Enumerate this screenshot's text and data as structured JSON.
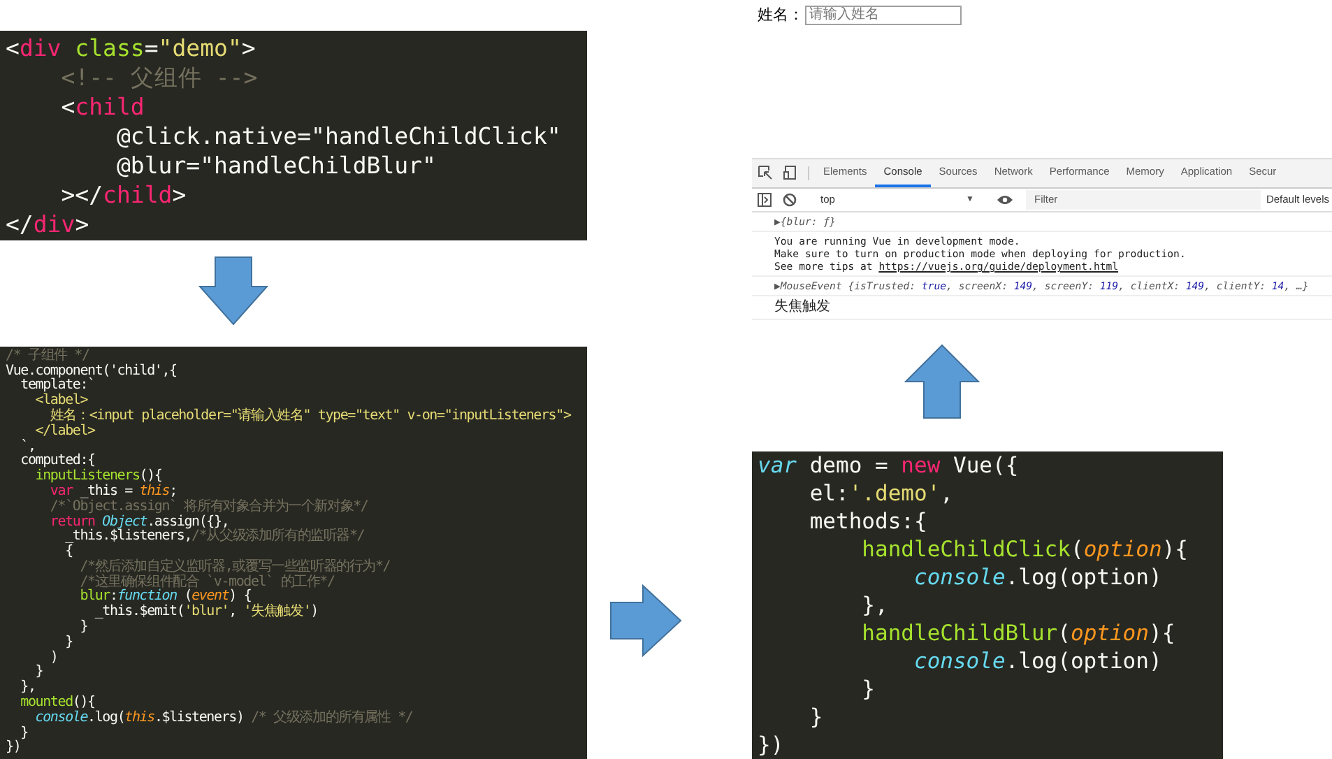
{
  "parent_template": {
    "lines": [
      [
        {
          "kind": "plain",
          "text": "<"
        },
        {
          "kind": "tag",
          "text": "div"
        },
        {
          "kind": "attr",
          "text": " class"
        },
        {
          "kind": "plain",
          "text": "="
        },
        {
          "kind": "string",
          "text": "\"demo\""
        },
        {
          "kind": "plain",
          "text": ">"
        }
      ],
      [
        {
          "kind": "comment",
          "text": "    <!-- 父组件 -->"
        }
      ],
      [
        {
          "kind": "plain",
          "text": "    <"
        },
        {
          "kind": "tag",
          "text": "child"
        }
      ],
      [
        {
          "kind": "plain",
          "text": "        @click.native="
        },
        {
          "kind": "plain",
          "text": "\"handleChildClick\""
        }
      ],
      [
        {
          "kind": "plain",
          "text": "        @blur="
        },
        {
          "kind": "plain",
          "text": "\"handleChildBlur\""
        }
      ],
      [
        {
          "kind": "plain",
          "text": "    ></"
        },
        {
          "kind": "tag",
          "text": "child"
        },
        {
          "kind": "plain",
          "text": ">"
        }
      ],
      [
        {
          "kind": "plain",
          "text": "</"
        },
        {
          "kind": "tag",
          "text": "div"
        },
        {
          "kind": "plain",
          "text": ">"
        }
      ]
    ]
  },
  "component_code": {
    "lines": [
      [
        {
          "kind": "comment",
          "text": "/* 子组件 */"
        }
      ],
      [
        {
          "kind": "plain",
          "text": "Vue.component('child',{"
        }
      ],
      [
        {
          "kind": "plain",
          "text": "  template:`"
        }
      ],
      [
        {
          "kind": "string",
          "text": "    <label>"
        }
      ],
      [
        {
          "kind": "string",
          "text": "      姓名：<input placeholder=\"请输入姓名\" type=\"text\" v-on=\"inputListeners\">"
        }
      ],
      [
        {
          "kind": "string",
          "text": "    </label>"
        }
      ],
      [
        {
          "kind": "plain",
          "text": "  `,"
        }
      ],
      [
        {
          "kind": "plain",
          "text": "  computed:{"
        }
      ],
      [
        {
          "kind": "func",
          "text": "    inputListeners"
        },
        {
          "kind": "plain",
          "text": "(){"
        }
      ],
      [
        {
          "kind": "keyword",
          "text": "      var"
        },
        {
          "kind": "plain",
          "text": " _this = "
        },
        {
          "kind": "param",
          "text": "this"
        },
        {
          "kind": "plain",
          "text": ";"
        }
      ],
      [
        {
          "kind": "comment",
          "text": "      /*`Object.assign` 将所有对象合并为一个新对象*/"
        }
      ],
      [
        {
          "kind": "keyword",
          "text": "      return"
        },
        {
          "kind": "builtin",
          "text": " Object"
        },
        {
          "kind": "plain",
          "text": ".assign({},"
        }
      ],
      [
        {
          "kind": "plain",
          "text": "        _this.$listeners,"
        },
        {
          "kind": "comment",
          "text": "/*从父级添加所有的监听器*/"
        }
      ],
      [
        {
          "kind": "plain",
          "text": "        {"
        }
      ],
      [
        {
          "kind": "comment",
          "text": "          /*然后添加自定义监听器,或覆写一些监听器的行为*/"
        }
      ],
      [
        {
          "kind": "comment",
          "text": "          /*这里确保组件配合 `v-model` 的工作*/"
        }
      ],
      [
        {
          "kind": "func",
          "text": "          blur"
        },
        {
          "kind": "plain",
          "text": ":"
        },
        {
          "kind": "builtin",
          "text": "function"
        },
        {
          "kind": "plain",
          "text": " ("
        },
        {
          "kind": "param",
          "text": "event"
        },
        {
          "kind": "plain",
          "text": ") {"
        }
      ],
      [
        {
          "kind": "plain",
          "text": "            _this.$emit("
        },
        {
          "kind": "string",
          "text": "'blur'"
        },
        {
          "kind": "plain",
          "text": ", "
        },
        {
          "kind": "string",
          "text": "'失焦触发'"
        },
        {
          "kind": "plain",
          "text": ")"
        }
      ],
      [
        {
          "kind": "plain",
          "text": "          }"
        }
      ],
      [
        {
          "kind": "plain",
          "text": "        }"
        }
      ],
      [
        {
          "kind": "plain",
          "text": "      )"
        }
      ],
      [
        {
          "kind": "plain",
          "text": "    }"
        }
      ],
      [
        {
          "kind": "plain",
          "text": "  },"
        }
      ],
      [
        {
          "kind": "func",
          "text": "  mounted"
        },
        {
          "kind": "plain",
          "text": "(){"
        }
      ],
      [
        {
          "kind": "builtin",
          "text": "    console"
        },
        {
          "kind": "plain",
          "text": ".log("
        },
        {
          "kind": "param",
          "text": "this"
        },
        {
          "kind": "plain",
          "text": ".$listeners) "
        },
        {
          "kind": "comment",
          "text": "/* 父级添加的所有属性 */"
        }
      ],
      [
        {
          "kind": "plain",
          "text": "  }"
        }
      ],
      [
        {
          "kind": "plain",
          "text": "})"
        }
      ]
    ]
  },
  "vue_instance_code": {
    "lines": [
      [
        {
          "kind": "builtin",
          "text": "var"
        },
        {
          "kind": "plain",
          "text": " demo = "
        },
        {
          "kind": "keyword",
          "text": "new"
        },
        {
          "kind": "plain",
          "text": " Vue({"
        }
      ],
      [
        {
          "kind": "plain",
          "text": "    el:"
        },
        {
          "kind": "string",
          "text": "'.demo'"
        },
        {
          "kind": "plain",
          "text": ","
        }
      ],
      [
        {
          "kind": "plain",
          "text": "    methods:{"
        }
      ],
      [
        {
          "kind": "func",
          "text": "        handleChildClick"
        },
        {
          "kind": "plain",
          "text": "("
        },
        {
          "kind": "param",
          "text": "option"
        },
        {
          "kind": "plain",
          "text": "){"
        }
      ],
      [
        {
          "kind": "builtin",
          "text": "            console"
        },
        {
          "kind": "plain",
          "text": ".log(option)"
        }
      ],
      [
        {
          "kind": "plain",
          "text": "        },"
        }
      ],
      [
        {
          "kind": "func",
          "text": "        handleChildBlur"
        },
        {
          "kind": "plain",
          "text": "("
        },
        {
          "kind": "param",
          "text": "option"
        },
        {
          "kind": "plain",
          "text": "){"
        }
      ],
      [
        {
          "kind": "builtin",
          "text": "            console"
        },
        {
          "kind": "plain",
          "text": ".log(option)"
        }
      ],
      [
        {
          "kind": "plain",
          "text": "        }"
        }
      ],
      [
        {
          "kind": "plain",
          "text": "    }"
        }
      ],
      [
        {
          "kind": "plain",
          "text": "})"
        }
      ]
    ]
  },
  "arrows": [
    {
      "kind": "down"
    },
    {
      "kind": "right"
    },
    {
      "kind": "up"
    }
  ],
  "preview": {
    "label": "姓名：",
    "input": {
      "placeholder": "请输入姓名"
    }
  },
  "devtools": {
    "tabs": [
      {
        "label": "Elements",
        "selected": false
      },
      {
        "label": "Console",
        "selected": true
      },
      {
        "label": "Sources",
        "selected": false
      },
      {
        "label": "Network",
        "selected": false
      },
      {
        "label": "Performance",
        "selected": false
      },
      {
        "label": "Memory",
        "selected": false
      },
      {
        "label": "Application",
        "selected": false
      },
      {
        "label": "Secur",
        "selected": false
      }
    ],
    "context": {
      "value": "top",
      "caret": "▼"
    },
    "filter": {
      "placeholder": "Filter"
    },
    "levels": "Default levels",
    "messages": [
      {
        "kind": "object",
        "toggle": "▶",
        "parts": [
          {
            "kind": "object",
            "text": "{blur: ƒ}"
          }
        ]
      },
      {
        "kind": "info",
        "lines": [
          "You are running Vue in development mode.",
          "Make sure to turn on production mode when deploying for production."
        ],
        "prefix": "See more tips at ",
        "link": "https://vuejs.org/guide/deployment.html"
      },
      {
        "kind": "object",
        "toggle": "▶",
        "parts": [
          {
            "kind": "object",
            "text": "MouseEvent {isTrusted: "
          },
          {
            "kind": "value",
            "text": "true"
          },
          {
            "kind": "object",
            "text": ", screenX: "
          },
          {
            "kind": "value",
            "text": "149"
          },
          {
            "kind": "object",
            "text": ", screenY: "
          },
          {
            "kind": "value",
            "text": "119"
          },
          {
            "kind": "object",
            "text": ", clientX: "
          },
          {
            "kind": "value",
            "text": "149"
          },
          {
            "kind": "object",
            "text": ", clientY: "
          },
          {
            "kind": "value",
            "text": "14"
          },
          {
            "kind": "object",
            "text": ", …}"
          }
        ]
      },
      {
        "kind": "log",
        "text": "失焦触发"
      }
    ]
  }
}
